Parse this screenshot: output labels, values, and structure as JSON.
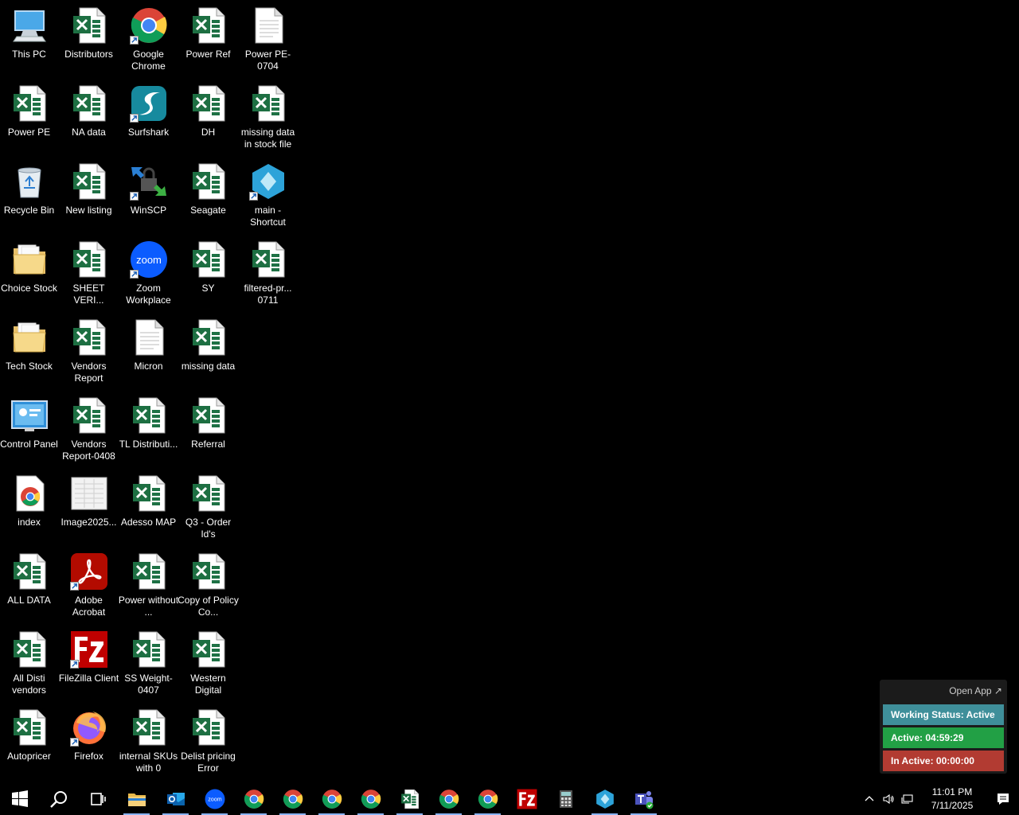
{
  "desktop": {
    "icons": [
      {
        "label": "This PC",
        "icon": "this-pc-icon"
      },
      {
        "label": "Distributors",
        "icon": "excel-icon"
      },
      {
        "label": "Google Chrome",
        "icon": "chrome-icon"
      },
      {
        "label": "Power Ref",
        "icon": "excel-icon"
      },
      {
        "label": "Power PE-0704",
        "icon": "document-icon"
      },
      {
        "label": "Power PE",
        "icon": "excel-icon"
      },
      {
        "label": "NA data",
        "icon": "excel-icon"
      },
      {
        "label": "Surfshark",
        "icon": "surfshark-icon"
      },
      {
        "label": "DH",
        "icon": "excel-icon"
      },
      {
        "label": "missing data in stock file",
        "icon": "excel-icon"
      },
      {
        "label": "Recycle Bin",
        "icon": "recycle-bin-icon"
      },
      {
        "label": "New listing",
        "icon": "excel-icon"
      },
      {
        "label": "WinSCP",
        "icon": "winscp-icon"
      },
      {
        "label": "Seagate",
        "icon": "excel-icon"
      },
      {
        "label": "main - Shortcut",
        "icon": "app-diamond-icon"
      },
      {
        "label": "Choice Stock",
        "icon": "folder-icon"
      },
      {
        "label": "SHEET VERI...",
        "icon": "excel-icon"
      },
      {
        "label": "Zoom Workplace",
        "icon": "zoom-icon"
      },
      {
        "label": "SY",
        "icon": "excel-icon"
      },
      {
        "label": "filtered-pr... 0711",
        "icon": "excel-icon"
      },
      {
        "label": "Tech Stock",
        "icon": "folder-icon"
      },
      {
        "label": "Vendors Report",
        "icon": "excel-icon"
      },
      {
        "label": "Micron",
        "icon": "document-icon"
      },
      {
        "label": "missing data",
        "icon": "excel-icon"
      },
      {
        "label": "Control Panel",
        "icon": "control-panel-icon"
      },
      {
        "label": "Vendors Report-0408",
        "icon": "excel-icon"
      },
      {
        "label": "TL Distributi...",
        "icon": "excel-icon"
      },
      {
        "label": "Referral",
        "icon": "excel-icon"
      },
      {
        "label": "index",
        "icon": "chrome-html-icon"
      },
      {
        "label": "Image2025...",
        "icon": "image-icon"
      },
      {
        "label": "Adesso MAP",
        "icon": "excel-icon"
      },
      {
        "label": "Q3 - Order Id's",
        "icon": "excel-icon"
      },
      {
        "label": "ALL DATA",
        "icon": "excel-icon"
      },
      {
        "label": "Adobe Acrobat",
        "icon": "acrobat-icon"
      },
      {
        "label": "Power without ...",
        "icon": "excel-icon"
      },
      {
        "label": "Copy of Policy Co...",
        "icon": "excel-icon"
      },
      {
        "label": "All Disti vendors",
        "icon": "excel-icon"
      },
      {
        "label": "FileZilla Client",
        "icon": "filezilla-icon"
      },
      {
        "label": "SS Weight-0407",
        "icon": "excel-icon"
      },
      {
        "label": "Western Digital",
        "icon": "excel-icon"
      },
      {
        "label": "Autopricer",
        "icon": "excel-icon"
      },
      {
        "label": "Firefox",
        "icon": "firefox-icon"
      },
      {
        "label": "internal SKUs with 0",
        "icon": "excel-icon"
      },
      {
        "label": "Delist pricing Error",
        "icon": "excel-icon"
      }
    ]
  },
  "widget": {
    "open_app": "Open App ↗",
    "working_status": "Working Status: Active",
    "active": "Active: 04:59:29",
    "inactive": "In Active: 00:00:00",
    "colors": {
      "status": "#3f8f9a",
      "active": "#22a045",
      "inactive": "#b23b32"
    }
  },
  "taskbar": {
    "buttons": [
      {
        "name": "start-button",
        "icon": "windows-icon"
      },
      {
        "name": "search-button",
        "icon": "search-icon"
      },
      {
        "name": "task-view-button",
        "icon": "task-view-icon"
      },
      {
        "name": "file-explorer-button",
        "icon": "folder-icon"
      },
      {
        "name": "outlook-button",
        "icon": "outlook-icon"
      },
      {
        "name": "zoom-button",
        "icon": "zoom-icon"
      },
      {
        "name": "chrome-profile-1-button",
        "icon": "chrome-icon"
      },
      {
        "name": "chrome-profile-2-button",
        "icon": "chrome-icon"
      },
      {
        "name": "chrome-profile-3-button",
        "icon": "chrome-icon"
      },
      {
        "name": "chrome-profile-4-button",
        "icon": "chrome-icon"
      },
      {
        "name": "excel-button",
        "icon": "excel-icon"
      },
      {
        "name": "chrome-profile-5-button",
        "icon": "chrome-icon"
      },
      {
        "name": "chrome-profile-6-button",
        "icon": "chrome-icon"
      },
      {
        "name": "filezilla-button",
        "icon": "filezilla-icon"
      },
      {
        "name": "calculator-button",
        "icon": "calculator-icon"
      },
      {
        "name": "app-diamond-button",
        "icon": "app-diamond-icon"
      },
      {
        "name": "teams-button",
        "icon": "teams-icon"
      }
    ],
    "clock": {
      "time": "11:01 PM",
      "date": "7/11/2025"
    }
  }
}
